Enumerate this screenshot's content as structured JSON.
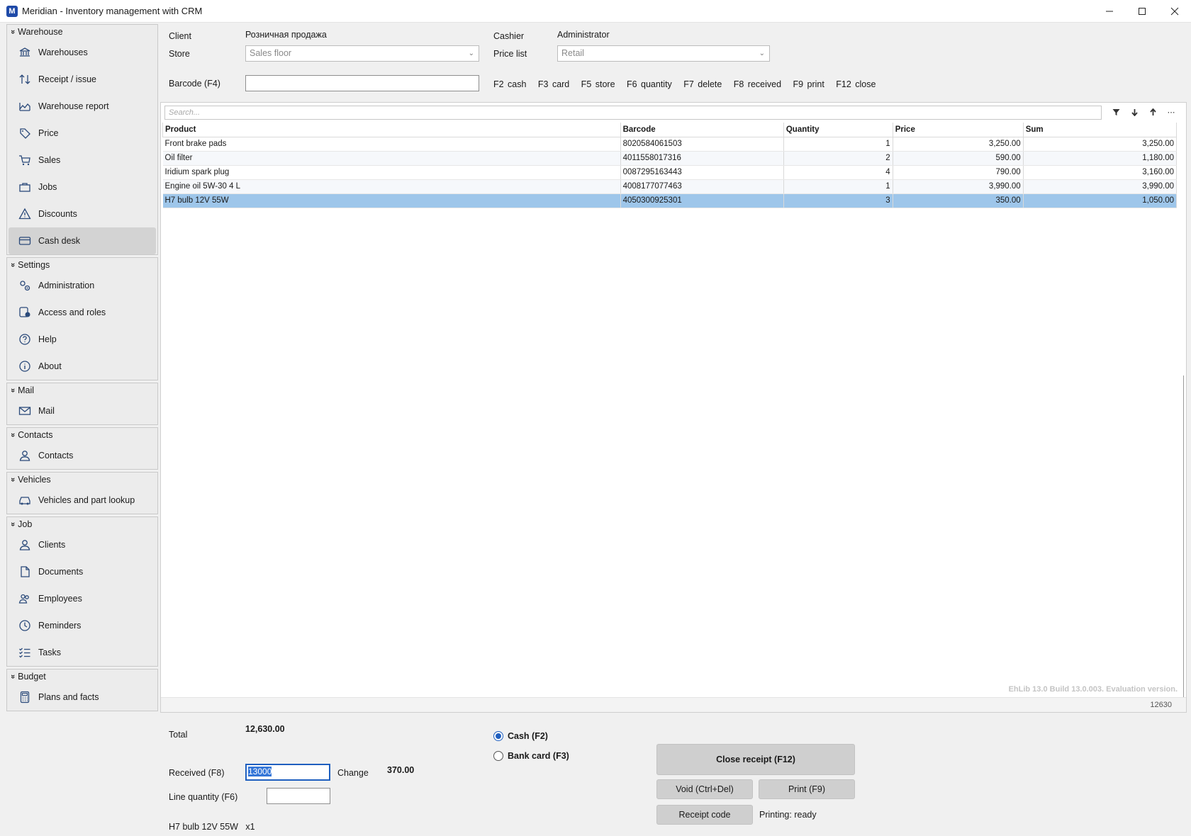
{
  "window": {
    "title": "Meridian - Inventory management with CRM",
    "icon_letter": "M"
  },
  "sidebar": {
    "groups": [
      {
        "label": "Warehouse",
        "items": [
          {
            "label": "Warehouses",
            "icon": "bank-icon"
          },
          {
            "label": "Receipt / issue",
            "icon": "arrows-updown-icon"
          },
          {
            "label": "Warehouse report",
            "icon": "area-chart-icon"
          },
          {
            "label": "Price",
            "icon": "tag-icon"
          },
          {
            "label": "Sales",
            "icon": "cart-icon"
          },
          {
            "label": "Jobs",
            "icon": "briefcase-icon"
          },
          {
            "label": "Discounts",
            "icon": "warning-icon"
          },
          {
            "label": "Cash desk",
            "icon": "card-icon",
            "active": true
          }
        ]
      },
      {
        "label": "Settings",
        "items": [
          {
            "label": "Administration",
            "icon": "gears-icon"
          },
          {
            "label": "Access and roles",
            "icon": "user-lock-icon"
          },
          {
            "label": "Help",
            "icon": "help-icon"
          },
          {
            "label": "About",
            "icon": "info-icon"
          }
        ]
      },
      {
        "label": "Mail",
        "items": [
          {
            "label": "Mail",
            "icon": "mail-icon"
          }
        ]
      },
      {
        "label": "Contacts",
        "items": [
          {
            "label": "Contacts",
            "icon": "person-icon"
          }
        ]
      },
      {
        "label": "Vehicles",
        "items": [
          {
            "label": "Vehicles and part lookup",
            "icon": "car-icon"
          }
        ]
      },
      {
        "label": "Job",
        "items": [
          {
            "label": "Clients",
            "icon": "person-icon"
          },
          {
            "label": "Documents",
            "icon": "document-icon"
          },
          {
            "label": "Employees",
            "icon": "people-icon"
          },
          {
            "label": "Reminders",
            "icon": "clock-icon"
          },
          {
            "label": "Tasks",
            "icon": "checklist-icon"
          }
        ]
      },
      {
        "label": "Budget",
        "items": [
          {
            "label": "Plans and facts",
            "icon": "calculator-icon"
          }
        ]
      }
    ]
  },
  "header": {
    "client_label": "Client",
    "client_value": "Розничная продажа",
    "store_label": "Store",
    "store_value": "Sales floor",
    "cashier_label": "Cashier",
    "cashier_value": "Administrator",
    "pricelist_label": "Price list",
    "pricelist_value": "Retail",
    "barcode_label": "Barcode (F4)",
    "barcode_value": "",
    "shortcuts": "F2 cash   F3 card   F5 store   F6 quantity   F7 delete   F8 received   F9 print   F12 close"
  },
  "grid": {
    "search_placeholder": "Search...",
    "columns": [
      "Product",
      "Barcode",
      "Quantity",
      "Price",
      "Sum"
    ],
    "rows": [
      [
        "Front brake pads",
        "8020584061503",
        "1",
        "3,250.00",
        "3,250.00"
      ],
      [
        "Oil filter",
        "4011558017316",
        "2",
        "590.00",
        "1,180.00"
      ],
      [
        "Iridium spark plug",
        "0087295163443",
        "4",
        "790.00",
        "3,160.00"
      ],
      [
        "Engine oil 5W-30 4 L",
        "4008177077463",
        "1",
        "3,990.00",
        "3,990.00"
      ],
      [
        "H7 bulb 12V 55W",
        "4050300925301",
        "3",
        "350.00",
        "1,050.00"
      ]
    ],
    "selected_row": 4,
    "watermark": "EhLib 13.0 Build 13.0.003. Evaluation version.",
    "footer_total": "12630"
  },
  "bottom": {
    "total_label": "Total",
    "total_value": "12,630.00",
    "received_label": "Received (F8)",
    "received_value": "13000",
    "change_label": "Change",
    "change_value": "370.00",
    "linequantity_label": "Line quantity (F6)",
    "linequantity_value": "",
    "cash_label": "Cash (F2)",
    "card_label": "Bank card (F3)",
    "close_button": "Close receipt (F12)",
    "void_button": "Void (Ctrl+Del)",
    "print_button": "Print (F9)",
    "receipt_code_button": "Receipt code",
    "printing_status": "Printing: ready",
    "current_line": "H7 bulb 12V 55W   x1"
  }
}
